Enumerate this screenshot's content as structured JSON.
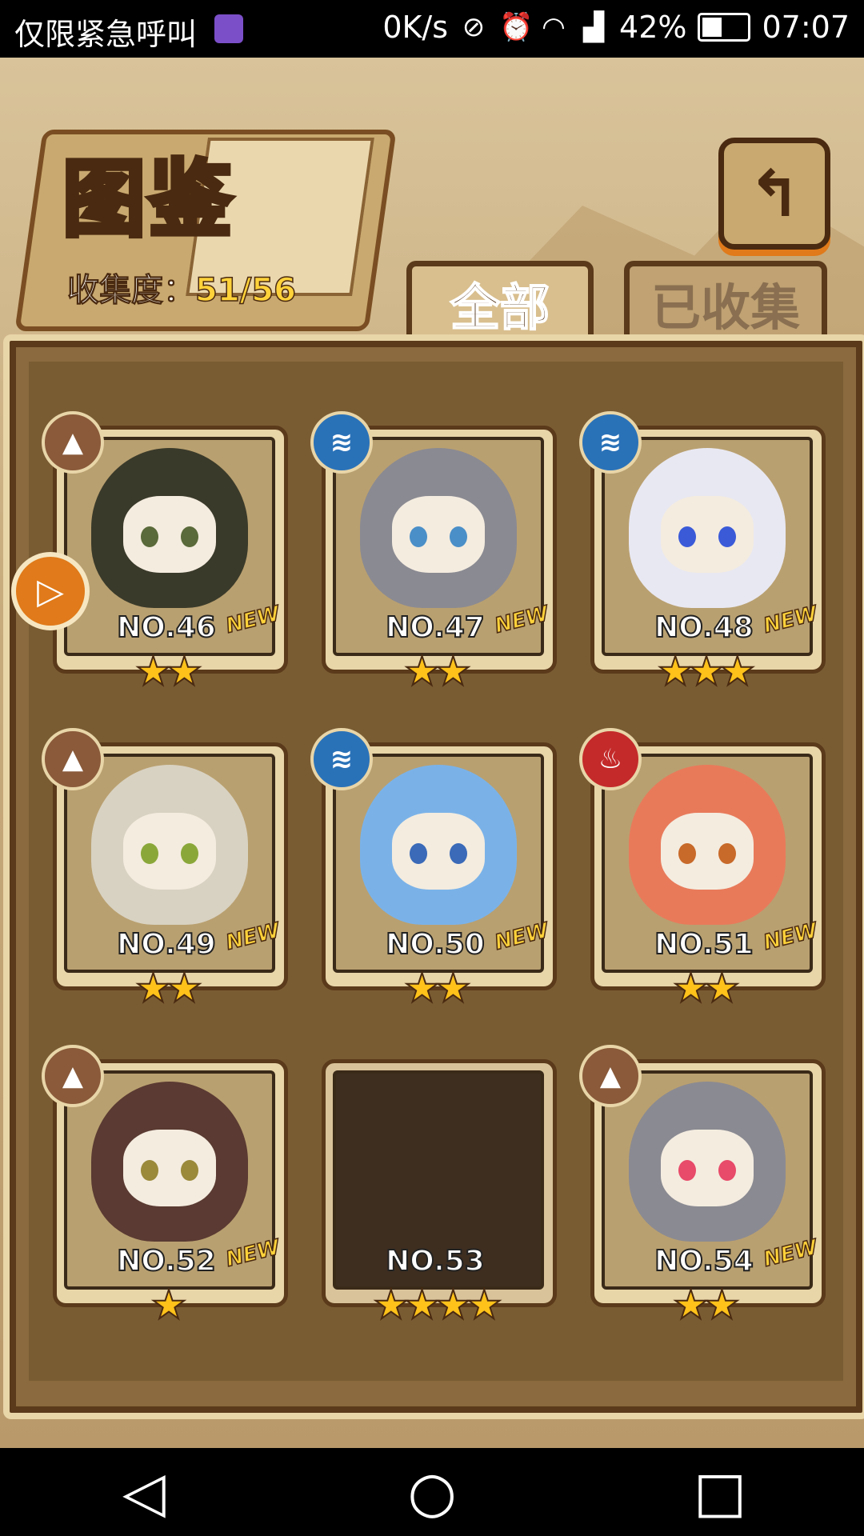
{
  "status_bar": {
    "left_text": "仅限紧急呼叫",
    "speed": "0K/s",
    "battery": "42%",
    "time": "07:07"
  },
  "header": {
    "title": "图鉴",
    "collect_label": "收集度：",
    "collect_value": "51/56",
    "back_icon": "back-arrow-icon"
  },
  "tabs": [
    {
      "label": "全部",
      "active": true
    },
    {
      "label": "已收集",
      "active": false
    }
  ],
  "cards": [
    {
      "no": "NO.46",
      "new": "NEW",
      "stars": "★★",
      "element": "earth",
      "hair": "#3a3a2a",
      "eye": "#5a6a3a"
    },
    {
      "no": "NO.47",
      "new": "NEW",
      "stars": "★★",
      "element": "water",
      "hair": "#8a8a92",
      "eye": "#4a8fc8"
    },
    {
      "no": "NO.48",
      "new": "NEW",
      "stars": "★★★",
      "element": "water",
      "hair": "#e8e8f2",
      "eye": "#3a5ad8"
    },
    {
      "no": "NO.49",
      "new": "NEW",
      "stars": "★★",
      "element": "earth",
      "hair": "#d8d2c2",
      "eye": "#8aa83a"
    },
    {
      "no": "NO.50",
      "new": "NEW",
      "stars": "★★",
      "element": "water",
      "hair": "#7ab2e8",
      "eye": "#3a6ab8"
    },
    {
      "no": "NO.51",
      "new": "NEW",
      "stars": "★★",
      "element": "fire",
      "hair": "#e87a5a",
      "eye": "#c86a2a"
    },
    {
      "no": "NO.52",
      "new": "NEW",
      "stars": "★",
      "element": "earth",
      "hair": "#5a3a32",
      "eye": "#9a8a3a"
    },
    {
      "no": "NO.53",
      "new": "",
      "stars": "★★★★",
      "element": "",
      "hair": "",
      "eye": ""
    },
    {
      "no": "NO.54",
      "new": "NEW",
      "stars": "★★",
      "element": "earth",
      "hair": "#8a8a92",
      "eye": "#e84a6a"
    }
  ],
  "element_icons": {
    "earth": "mountain-icon",
    "water": "wave-icon",
    "fire": "flame-icon"
  },
  "colors": {
    "accent": "#ffd23a",
    "frame": "#e8d5a8",
    "dark": "#4a2a10"
  },
  "nav": {
    "back": "back-triangle-icon",
    "home": "home-circle-icon",
    "recents": "recents-square-icon"
  }
}
